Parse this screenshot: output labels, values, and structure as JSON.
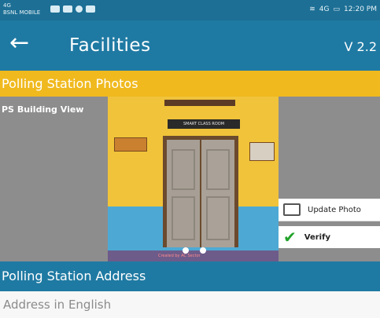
{
  "status_bar": {
    "network_small": "4G",
    "carrier": "BSNL MOBILE",
    "signal_text": "4G",
    "battery": "",
    "time": "12:20 PM"
  },
  "app_bar": {
    "back_icon": "arrow-left-icon",
    "title": "Facilities",
    "version": "V 2.2"
  },
  "photos_section": {
    "title": "Polling Station Photos",
    "photo_label": "PS Building View",
    "sign_text": "SMART CLASS ROOM",
    "caption": "Created by AC Sector",
    "update_photo_label": "Update Photo",
    "verify_label": "Verify",
    "carousel_count": 2,
    "carousel_active": 0
  },
  "address_section": {
    "title": "Polling Station Address",
    "field_placeholder": "Address in English"
  },
  "colors": {
    "primary": "#1f7aa3",
    "accent": "#f0b91e",
    "verify_check": "#22a32a"
  }
}
